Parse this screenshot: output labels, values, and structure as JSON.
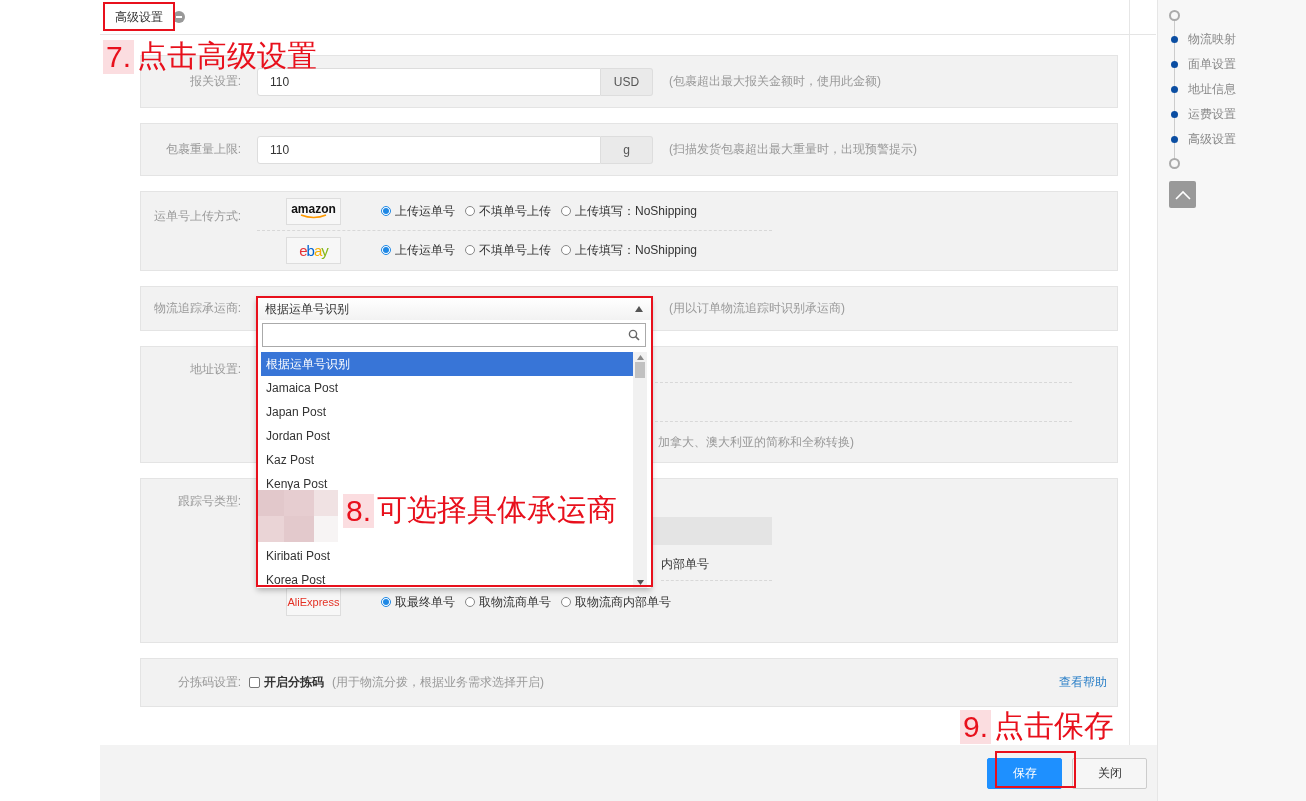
{
  "header": {
    "tab": "高级设置"
  },
  "customs": {
    "label": "报关设置:",
    "value": "110",
    "unit": "USD",
    "hint": "(包裹超出最大报关金额时，使用此金额)"
  },
  "weight": {
    "label": "包裹重量上限:",
    "value": "110",
    "unit": "g",
    "hint": "(扫描发货包裹超出最大重量时，出现预警提示)"
  },
  "upload": {
    "label": "运单号上传方式:",
    "rows": [
      {
        "kind": "amazon",
        "logo": "amazon",
        "options": [
          {
            "label": "上传运单号",
            "selected": true
          },
          {
            "label": "不填单号上传",
            "selected": false
          },
          {
            "label": "上传填写：NoShipping",
            "selected": false
          }
        ]
      },
      {
        "kind": "ebay",
        "logo": "ebay",
        "options": [
          {
            "label": "上传运单号",
            "selected": true
          },
          {
            "label": "不填单号上传",
            "selected": false
          },
          {
            "label": "上传填写：NoShipping",
            "selected": false
          }
        ]
      }
    ]
  },
  "carrier": {
    "label": "物流追踪承运商:",
    "hint": "(用以订单物流追踪时识别承运商)"
  },
  "address": {
    "label": "地址设置:",
    "hint": "加拿大、澳大利亚的简称和全称转换)"
  },
  "tracking": {
    "label": "跟踪号类型:",
    "partial_text": "内部单号",
    "rows": [
      {
        "kind": "aliexpress",
        "logo": "AliExpress",
        "options": [
          {
            "label": "取最终单号",
            "selected": true
          },
          {
            "label": "取物流商单号",
            "selected": false
          },
          {
            "label": "取物流商内部单号",
            "selected": false
          }
        ]
      }
    ]
  },
  "sorting": {
    "label": "分拣码设置:",
    "checkbox": {
      "label": "开启分拣码",
      "checked": false
    },
    "hint": "(用于物流分拨，根据业务需求选择开启)",
    "help_link": "查看帮助"
  },
  "dropdown": {
    "value": "根据运单号识别",
    "items": [
      {
        "label": "根据运单号识别",
        "selected": true
      },
      {
        "label": "Jamaica Post",
        "selected": false
      },
      {
        "label": "Japan Post",
        "selected": false
      },
      {
        "label": "Jordan Post",
        "selected": false
      },
      {
        "label": "Kaz Post",
        "selected": false
      },
      {
        "label": "Kenya Post",
        "selected": false
      },
      {
        "kind": "hidden"
      },
      {
        "label": "Kiribati Post",
        "selected": false
      },
      {
        "label": "Korea Post",
        "selected": false
      }
    ]
  },
  "side_nav": {
    "items": [
      {
        "label": "物流映射"
      },
      {
        "label": "面单设置"
      },
      {
        "label": "地址信息"
      },
      {
        "label": "运费设置"
      },
      {
        "label": "高级设置"
      }
    ]
  },
  "buttons": [
    {
      "label": "保存",
      "kind": "primary"
    },
    {
      "label": "关闭",
      "kind": "default"
    }
  ],
  "annotations": [
    {
      "number": "7.",
      "text": "点击高级设置"
    },
    {
      "number": "8.",
      "text": "可选择具体承运商"
    },
    {
      "number": "9.",
      "text": "点击保存"
    }
  ]
}
